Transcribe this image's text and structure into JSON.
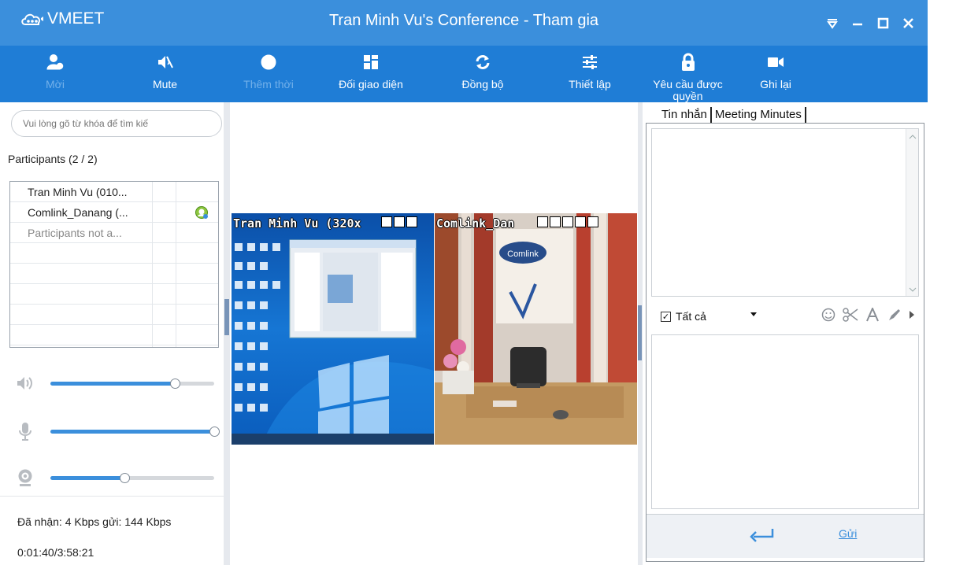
{
  "window": {
    "app_name": "VMEET",
    "title": "Tran Minh Vu's Conference - Tham gia",
    "controls": [
      "menu-down-icon",
      "minimize-icon",
      "maximize-icon",
      "close-icon"
    ]
  },
  "toolbar": {
    "items": [
      {
        "label": "Mời",
        "icon": "invite-user-icon",
        "enabled": false
      },
      {
        "label": "Mute",
        "icon": "mute-icon",
        "enabled": true
      },
      {
        "label": "Thêm thời",
        "icon": "clock-icon",
        "enabled": false
      },
      {
        "label": "Đối giao diện",
        "icon": "layout-icon",
        "enabled": true
      },
      {
        "label": "Đồng bộ",
        "icon": "sync-icon",
        "enabled": true
      },
      {
        "label": "Thiết lập",
        "icon": "settings-sliders-icon",
        "enabled": true
      },
      {
        "label": "Yêu cầu được quyền",
        "icon": "lock-icon",
        "enabled": true
      },
      {
        "label": "Ghi lại",
        "icon": "record-camera-icon",
        "enabled": true
      }
    ]
  },
  "left": {
    "search_placeholder": "Vui lòng gõ từ khóa để tìm kiế",
    "participants_header": "Participants (2 / 2)",
    "participants": [
      {
        "name": "Tran Minh Vu (010...",
        "muted": false
      },
      {
        "name": "Comlink_Danang (...",
        "muted": false
      },
      {
        "name": "Participants not a...",
        "muted": true
      }
    ],
    "sliders": {
      "speaker_level": 0.76,
      "mic_level": 1.0,
      "camera_level": 0.45
    },
    "stats": "Đã nhận: 4 Kbps gửi: 144 Kbps",
    "timer": "0:01:40/3:58:21"
  },
  "videos": [
    {
      "label": "Tran Minh Vu (320x"
    },
    {
      "label": "Comlink_Dan"
    }
  ],
  "chat": {
    "tabs": [
      "Tin nhắn",
      "Meeting Minutes"
    ],
    "recipient": "Tất cả",
    "recipient_checked": true,
    "format_icons": [
      "emoji-icon",
      "scissors-icon",
      "font-icon",
      "pen-icon",
      "more-arrow-icon"
    ],
    "send_label": "Gửi"
  },
  "colors": {
    "title_bar": "#3b8fdc",
    "toolbar": "#1f7dd6",
    "accent": "#3b8fdc"
  }
}
